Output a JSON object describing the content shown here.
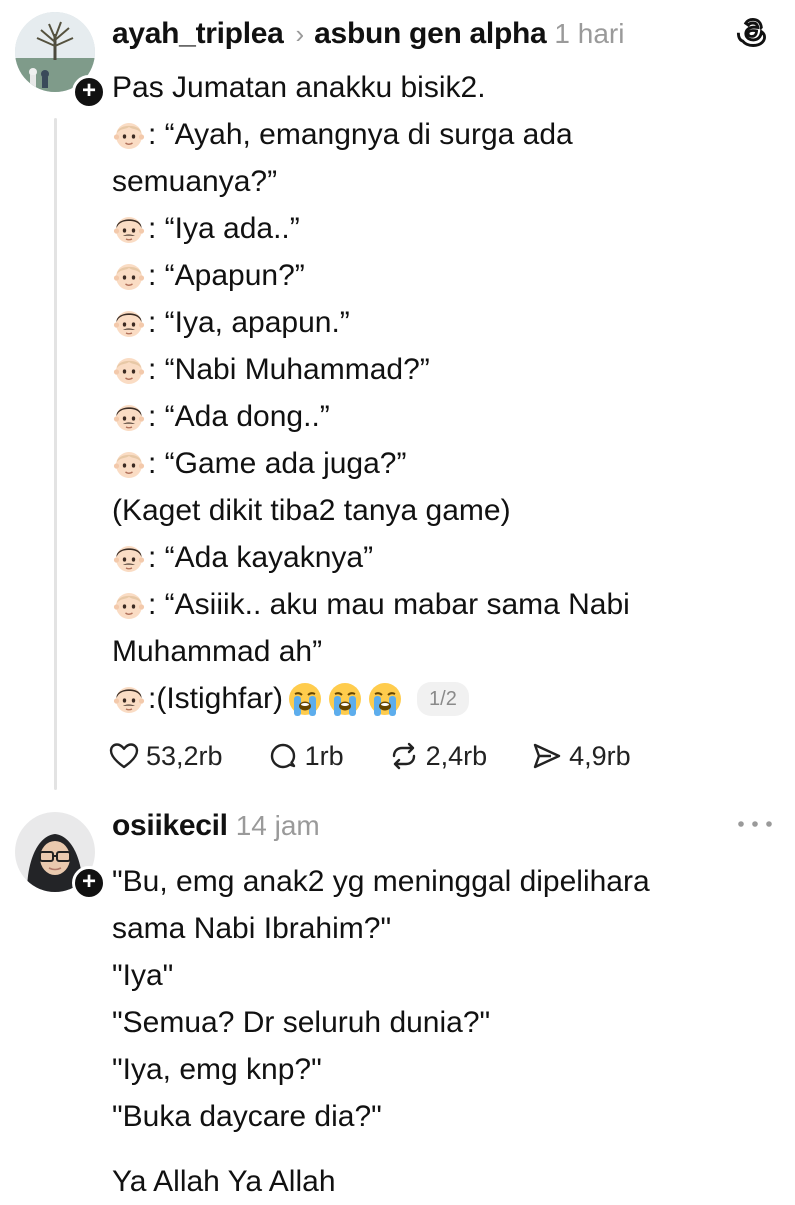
{
  "post1": {
    "username": "ayah_triplea",
    "community": "asbun gen alpha",
    "time": "1 hari",
    "lines": [
      {
        "speaker": "",
        "text": "Pas Jumatan anakku bisik2."
      },
      {
        "speaker": "child",
        "text": ": “Ayah, emangnya di surga ada"
      },
      {
        "speaker": "",
        "text": "semuanya?”"
      },
      {
        "speaker": "father",
        "text": ": “Iya ada..”"
      },
      {
        "speaker": "child",
        "text": ": “Apapun?”"
      },
      {
        "speaker": "father",
        "text": ": “Iya, apapun.”"
      },
      {
        "speaker": "child",
        "text": ": “Nabi Muhammad?”"
      },
      {
        "speaker": "father",
        "text": ": “Ada dong..”"
      },
      {
        "speaker": "child",
        "text": ": “Game ada juga?”"
      },
      {
        "speaker": "",
        "text": "(Kaget dikit tiba2 tanya game)"
      },
      {
        "speaker": "father",
        "text": ": “Ada kayaknya”"
      },
      {
        "speaker": "child",
        "text": ": “Asiiik.. aku mau mabar sama Nabi"
      },
      {
        "speaker": "",
        "text": "Muhammad ah”"
      }
    ],
    "last_line": {
      "speaker": "father",
      "text": ":(Istighfar)"
    },
    "pager": "1/2",
    "actions": {
      "likes": "53,2rb",
      "replies": "1rb",
      "reposts": "2,4rb",
      "shares": "4,9rb"
    },
    "icons": {
      "app": "threads-logo-icon",
      "like": "heart-icon",
      "reply": "comment-icon",
      "repost": "repost-icon",
      "share": "send-icon",
      "emoji_cry": "loudly-crying-face-emoji"
    }
  },
  "post2": {
    "username": "osiikecil",
    "time": "14 jam",
    "lines": [
      "\"Bu, emg anak2 yg meninggal dipelihara",
      "sama Nabi Ibrahim?\"",
      "\"Iya\"",
      "\"Semua? Dr seluruh dunia?\"",
      "\"Iya, emg knp?\"",
      "\"Buka daycare dia?\"",
      "",
      "Ya Allah Ya Allah"
    ]
  },
  "colors": {
    "text": "#111111",
    "muted": "#9a9a9a",
    "thread_line": "#e3e3e3"
  }
}
